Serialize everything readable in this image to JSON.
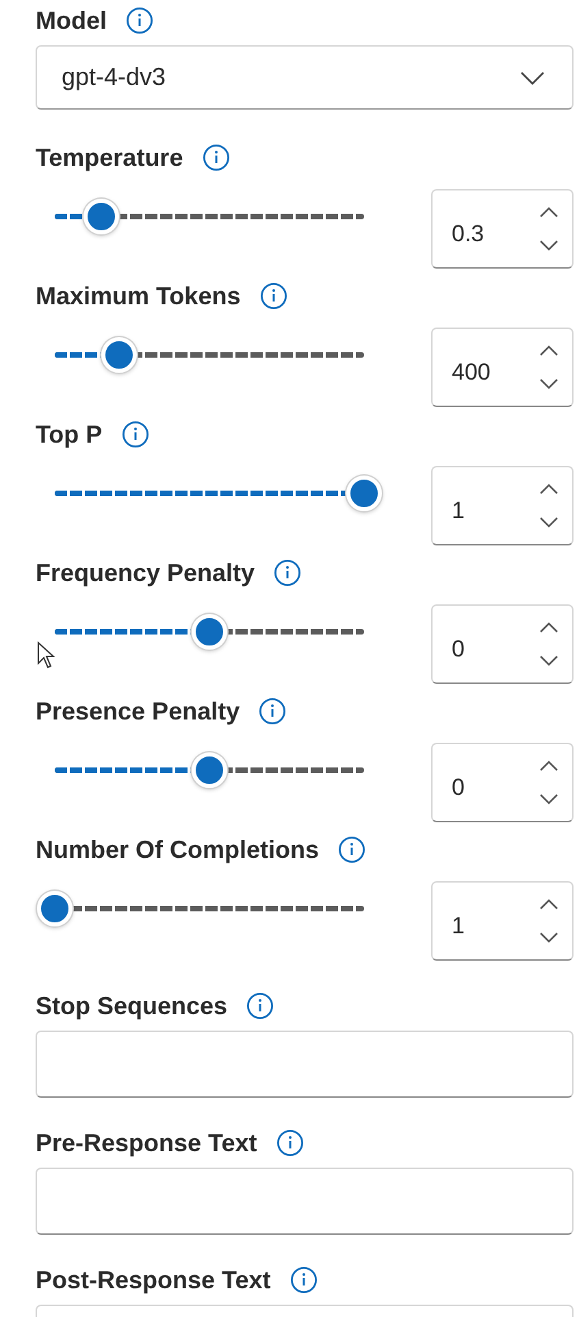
{
  "model": {
    "label": "Model",
    "value": "gpt-4-dv3"
  },
  "sliders": [
    {
      "label": "Temperature",
      "level": 0.15,
      "value": "0.3"
    },
    {
      "label": "Maximum Tokens",
      "level": 0.21,
      "value": "400"
    },
    {
      "label": "Top P",
      "level": 1,
      "value": "1"
    },
    {
      "label": "Frequency Penalty",
      "level": 0.5,
      "value": "0"
    },
    {
      "label": "Presence Penalty",
      "level": 0.5,
      "value": "0"
    },
    {
      "label": "Number Of Completions",
      "level": 0,
      "value": "1"
    }
  ],
  "text_fields": [
    {
      "label": "Stop Sequences"
    },
    {
      "label": "Pre-Response Text"
    },
    {
      "label": "Post-Response Text"
    }
  ]
}
